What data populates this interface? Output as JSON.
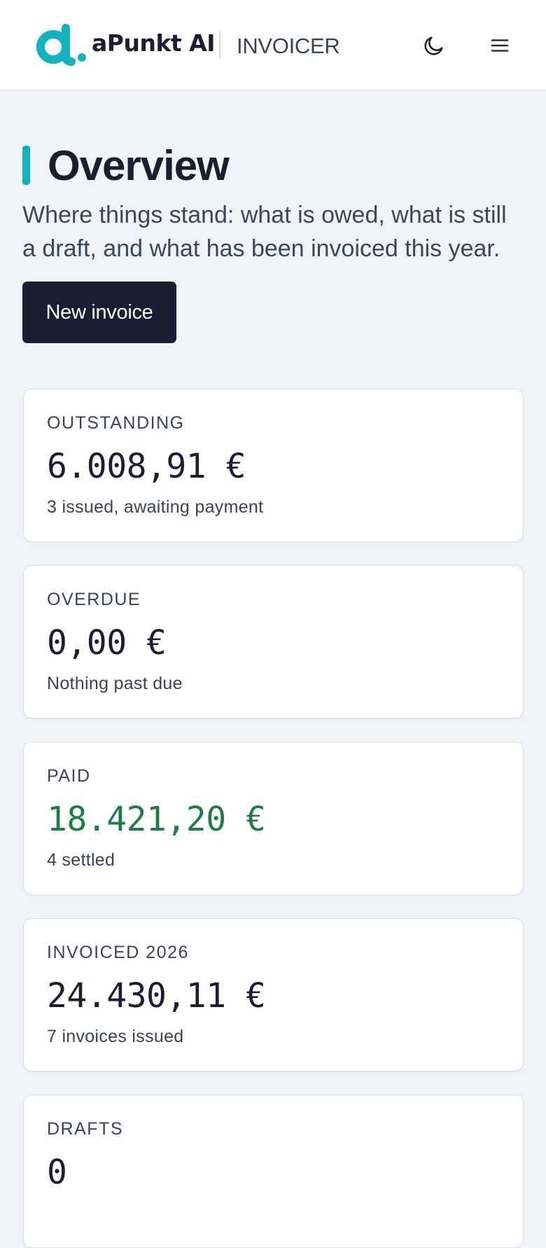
{
  "header": {
    "brand": "aPunkt AI",
    "app_name": "INVOICER",
    "theme_toggle_icon": "moon-icon",
    "menu_icon": "hamburger-menu-icon"
  },
  "page": {
    "title": "Overview",
    "subtitle": "Where things stand: what is owed, what is still a draft, and what has been invoiced this year.",
    "new_invoice_label": "New invoice"
  },
  "cards": [
    {
      "label": "OUTSTANDING",
      "value": "6.008,91 €",
      "note": "3 issued, awaiting payment"
    },
    {
      "label": "OVERDUE",
      "value": "0,00 €",
      "note": "Nothing past due"
    },
    {
      "label": "PAID",
      "value": "18.421,20 €",
      "note": "4 settled"
    },
    {
      "label": "INVOICED 2026",
      "value": "24.430,11 €",
      "note": "7 invoices issued"
    },
    {
      "label": "DRAFTS",
      "value": "0",
      "note": ""
    }
  ],
  "colors": {
    "accent": "#12b3be",
    "primary_dark": "#1b1d33",
    "paid_green": "#1e7d45",
    "background": "#eef4f7"
  }
}
